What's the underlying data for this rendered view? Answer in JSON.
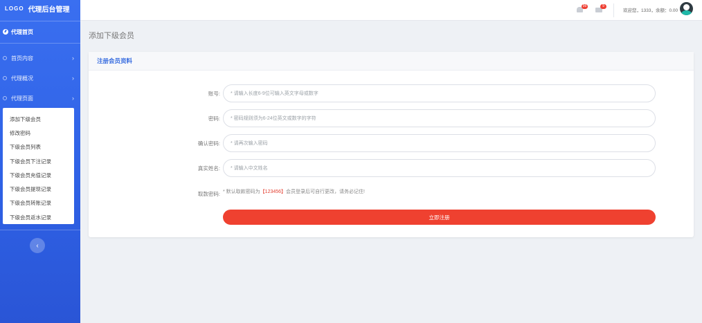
{
  "sidebar": {
    "logo": "LOGO",
    "title": "代理后台管理",
    "home": "代理首页",
    "menu": [
      {
        "label": "首页内容"
      },
      {
        "label": "代理概况"
      },
      {
        "label": "代理页面"
      }
    ],
    "submenu": [
      {
        "label": "添加下级会员"
      },
      {
        "label": "修改密码"
      },
      {
        "label": "下级会员列表"
      },
      {
        "label": "下级会员下注记录"
      },
      {
        "label": "下级会员充值记录"
      },
      {
        "label": "下级会员提现记录"
      },
      {
        "label": "下级会员转账记录"
      },
      {
        "label": "下级会员返水记录"
      }
    ],
    "collapse_glyph": "‹"
  },
  "header": {
    "bell_badge": "99",
    "mail_badge": "9",
    "welcome": "欢迎您，1333，余额：0.00"
  },
  "page": {
    "title": "添加下级会员",
    "panel_title": "注册会员资料"
  },
  "form": {
    "account": {
      "label": "账号:",
      "placeholder": "* 请输入长度6-9位可输入英文字母或数字"
    },
    "password": {
      "label": "密码:",
      "placeholder": "* 密码规则须为6-24位英文或数字的字符"
    },
    "confirm": {
      "label": "确认密码:",
      "placeholder": "* 请再次输入密码"
    },
    "realname": {
      "label": "真实姓名:",
      "placeholder": "* 请输入中文姓名"
    },
    "withdraw": {
      "label": "取款密码:",
      "prefix": "* 默认取款密码为",
      "value": "【123456】",
      "suffix": "会员登录后可自行更改，请务必记住!"
    },
    "submit": "立即注册"
  },
  "colors": {
    "sidebar": "#3a6ff0",
    "accent": "#3b6fe0",
    "button": "#ef4130"
  }
}
